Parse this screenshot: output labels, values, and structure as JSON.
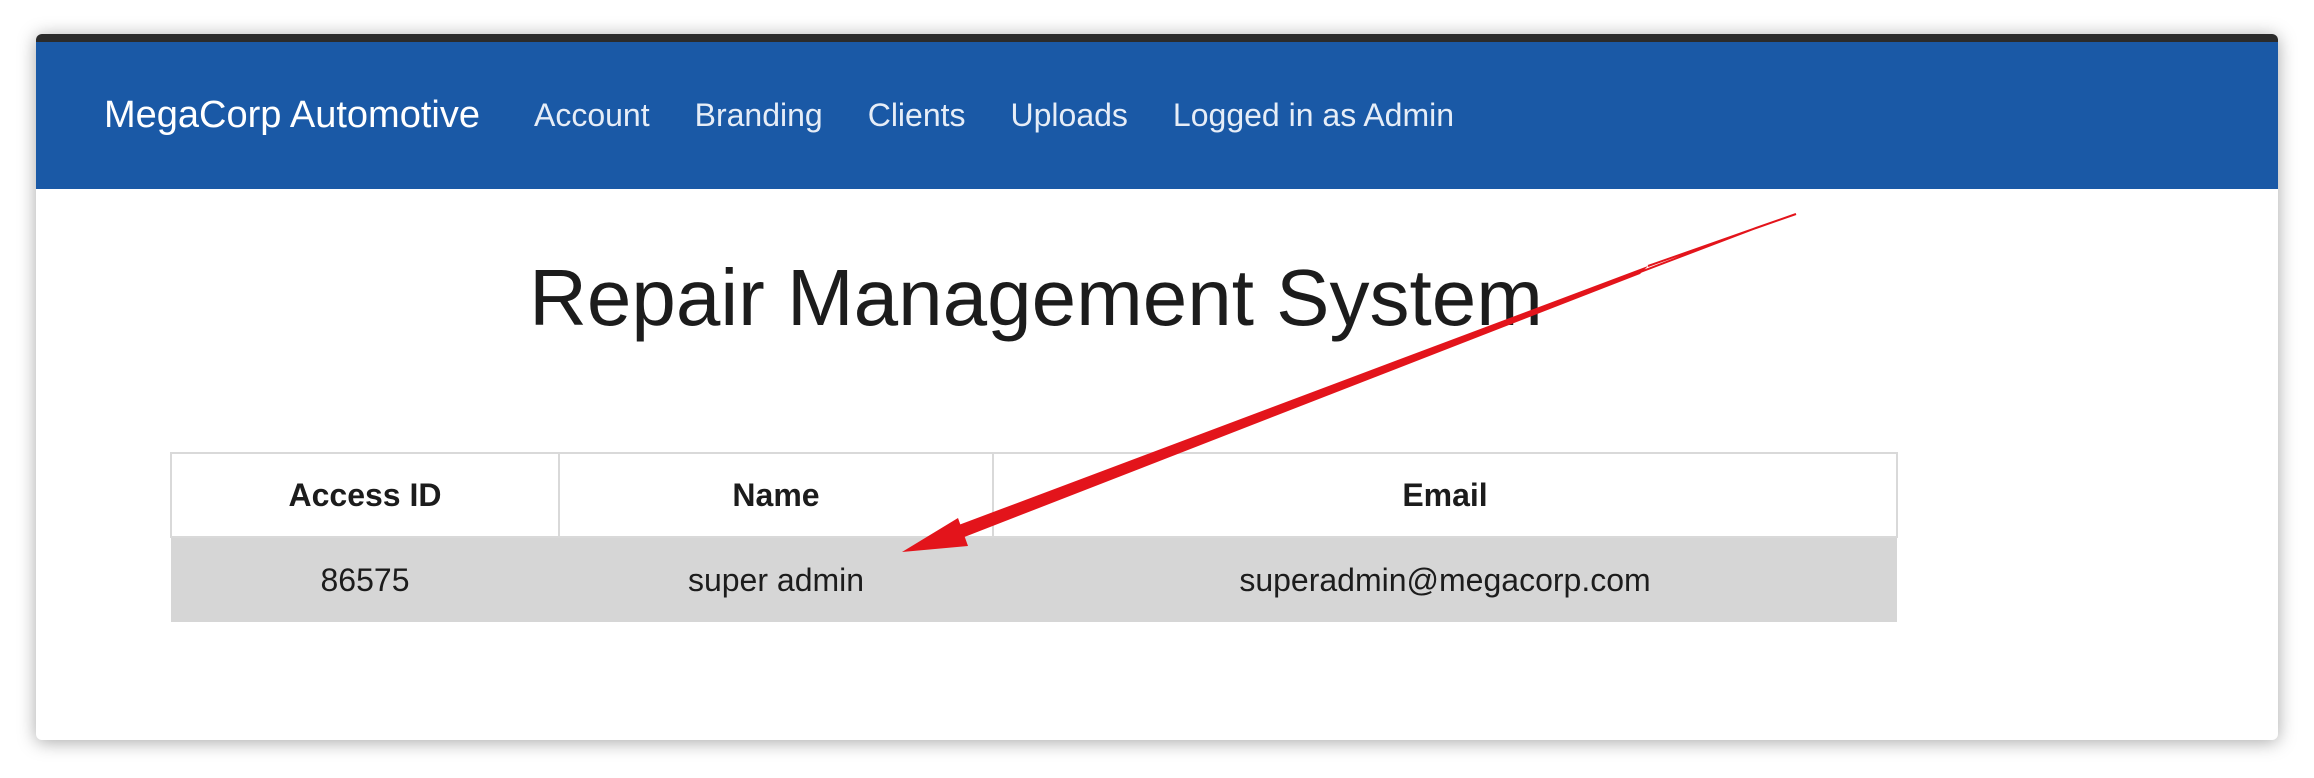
{
  "navbar": {
    "brand": "MegaCorp Automotive",
    "links": [
      "Account",
      "Branding",
      "Clients",
      "Uploads"
    ],
    "status": "Logged in as Admin"
  },
  "main": {
    "title": "Repair Management System",
    "table": {
      "headers": [
        "Access ID",
        "Name",
        "Email"
      ],
      "rows": [
        [
          "86575",
          "super admin",
          "superadmin@megacorp.com"
        ]
      ]
    }
  },
  "colors": {
    "navbar": "#1a59a6",
    "row_highlight": "#d6d6d6",
    "annotation_arrow": "#e3141b"
  }
}
